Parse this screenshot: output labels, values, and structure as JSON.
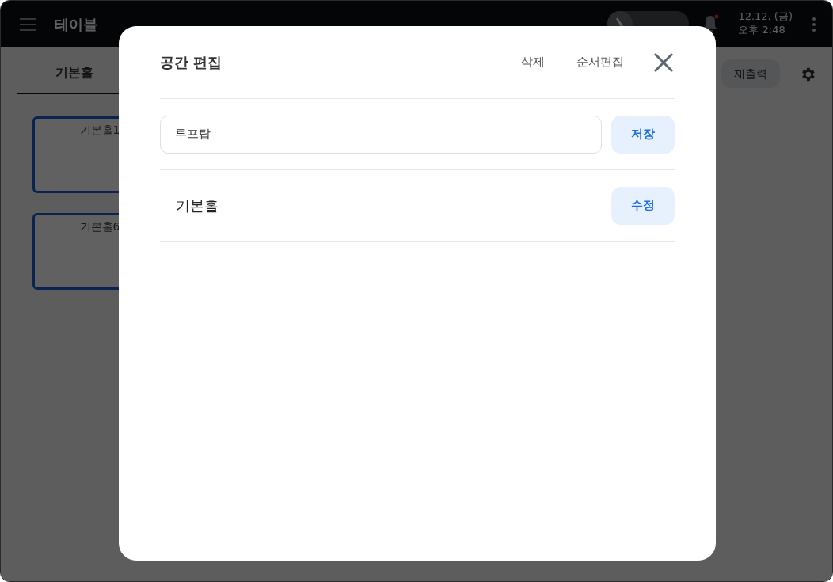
{
  "topbar": {
    "nav": [
      {
        "label": "테이블",
        "selected": true
      }
    ],
    "kiosk_toggle": {
      "on": false
    },
    "notification": {
      "unread": true
    },
    "date": "12.12. (금)",
    "time": "오후 2:48"
  },
  "area_tabs": [
    {
      "label": "기본홀",
      "selected": true
    }
  ],
  "reprint_button": "재출력",
  "tables": [
    {
      "name": "기본홀1"
    },
    {
      "name": "기본홀6"
    }
  ],
  "modal": {
    "title": "공간 편집",
    "actions": [
      "삭제",
      "순서편집"
    ],
    "new_area": {
      "value": "루프탑",
      "button": "저장"
    },
    "areas": [
      {
        "name": "기본홀",
        "button": "수정"
      }
    ]
  }
}
